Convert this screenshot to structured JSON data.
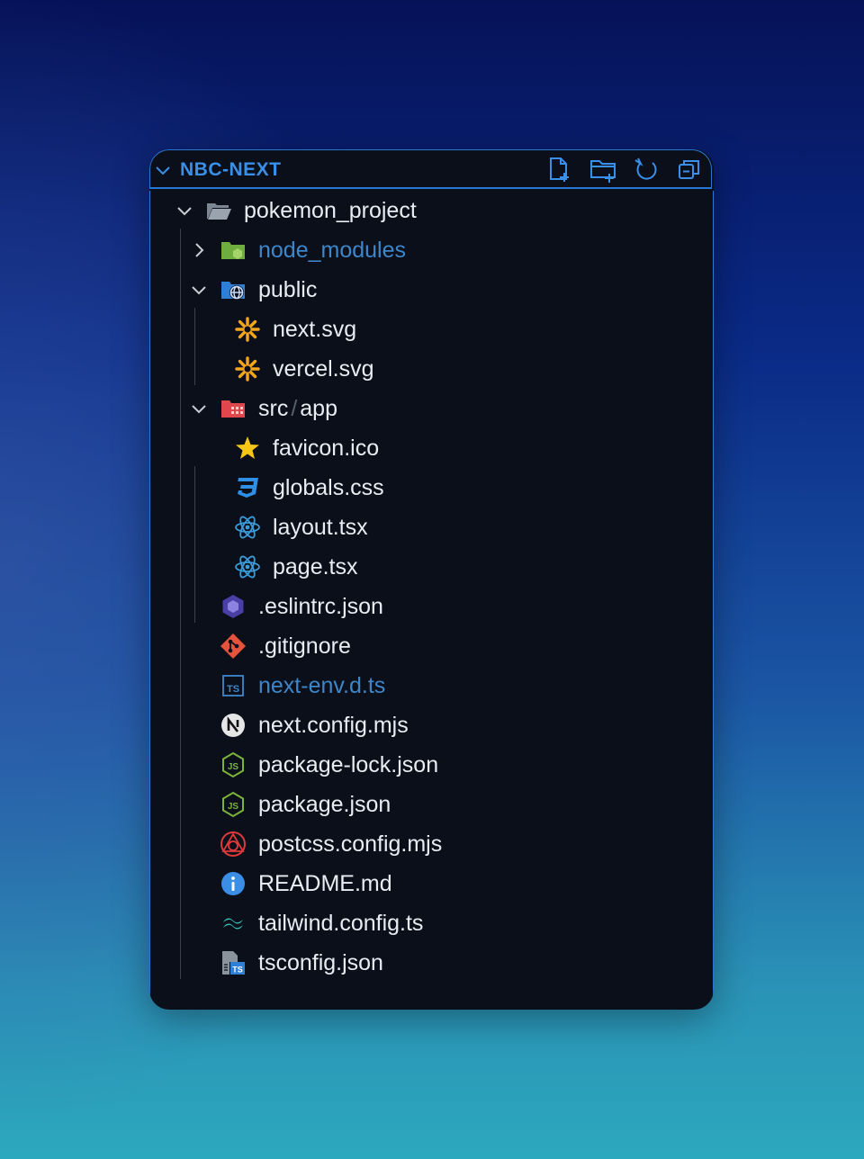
{
  "explorer": {
    "title": "NBC-NEXT",
    "actions": [
      {
        "name": "new-file-icon"
      },
      {
        "name": "new-folder-icon"
      },
      {
        "name": "refresh-icon"
      },
      {
        "name": "collapse-all-icon"
      }
    ]
  },
  "tree": {
    "root": "pokemon_project",
    "node_modules": "node_modules",
    "public": "public",
    "next_svg": "next.svg",
    "vercel_svg": "vercel.svg",
    "src": "src",
    "app": "app",
    "path_separator": "/",
    "favicon": "favicon.ico",
    "globals": "globals.css",
    "layout": "layout.tsx",
    "page": "page.tsx",
    "eslintrc": ".eslintrc.json",
    "gitignore": ".gitignore",
    "next_env": "next-env.d.ts",
    "next_config": "next.config.mjs",
    "package_lock": "package-lock.json",
    "package_json": "package.json",
    "postcss": "postcss.config.mjs",
    "readme": "README.md",
    "tailwind": "tailwind.config.ts",
    "tsconfig": "tsconfig.json"
  },
  "colors": {
    "accent": "#2a76d4",
    "text": "#e9edf2",
    "dim_text": "#3f86c9",
    "panel_bg": "#0a0f1a"
  }
}
